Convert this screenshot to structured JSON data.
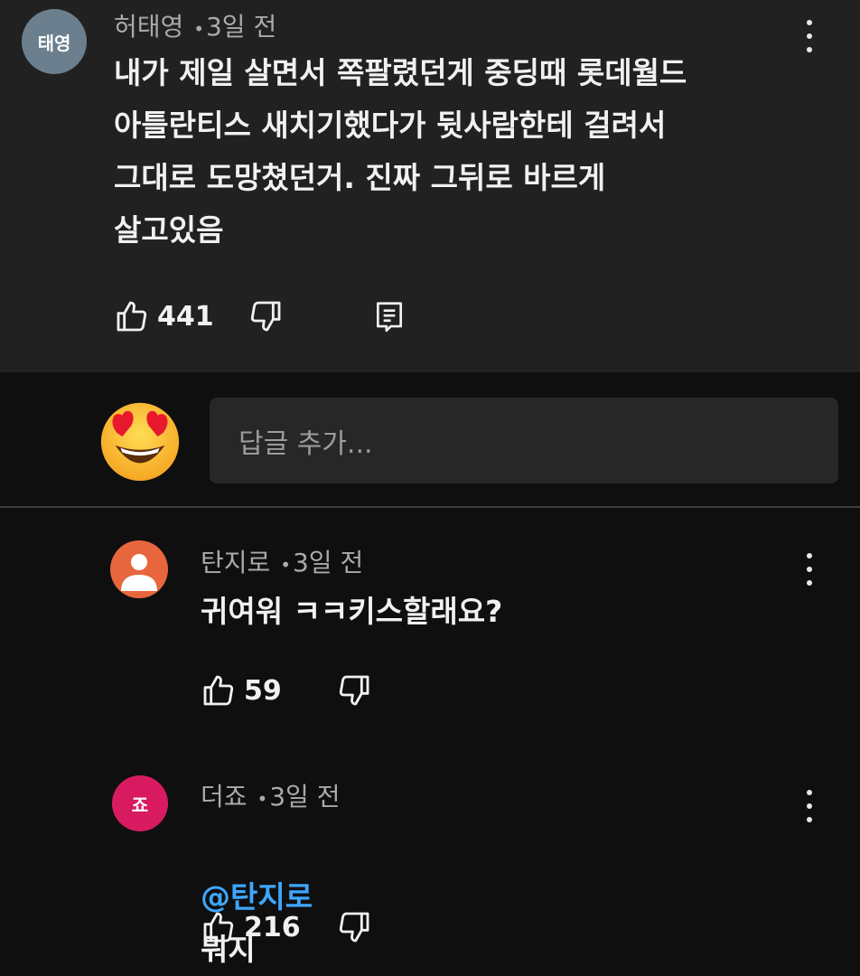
{
  "parent": {
    "avatar_text": "태영",
    "author": "허태영",
    "time": "3일 전",
    "text": "내가 제일 살면서 쪽팔렸던게 중딩때 롯데월드\n아틀란티스 새치기했다가 뒷사람한테 걸려서\n그대로 도망쳤던거. 진짜 그뒤로 바르게\n살고있음",
    "likes": "441"
  },
  "reply_box": {
    "placeholder": "답글 추가..."
  },
  "replies": [
    {
      "author": "탄지로",
      "time": "3일 전",
      "text": "귀여워 ㅋㅋ키스할래요?",
      "likes": "59"
    },
    {
      "avatar_text": "죠",
      "author": "더죠",
      "time": "3일 전",
      "mention": "@탄지로",
      "text": "뭐지",
      "likes": "216"
    }
  ],
  "meta_separator": "•",
  "colors": {
    "background": "#0f0f0f",
    "parent_bg": "#212121",
    "mention": "#3ea6ff",
    "avatar_parent": "#6b7f8e",
    "avatar_reply1": "#e8663d",
    "avatar_reply2": "#d81b60"
  },
  "icons": [
    "thumbs-up-icon",
    "thumbs-down-icon",
    "reply-comment-icon",
    "more-vert-icon",
    "heart-eyes-emoji-icon",
    "default-person-icon"
  ]
}
